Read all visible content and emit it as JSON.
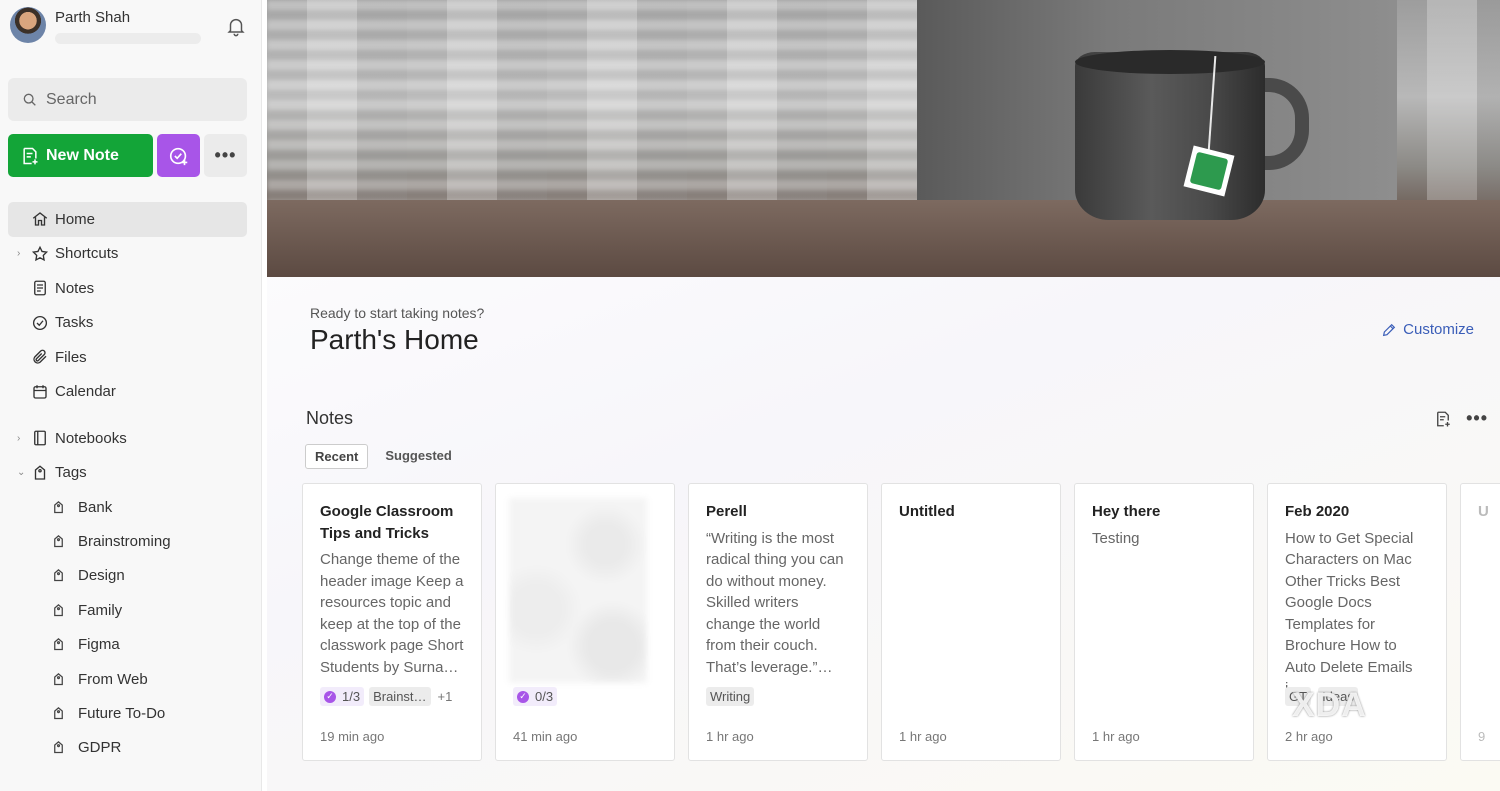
{
  "profile": {
    "name": "Parth Shah"
  },
  "search": {
    "placeholder": "Search"
  },
  "actions": {
    "new_note": "New Note"
  },
  "nav": {
    "home": "Home",
    "shortcuts": "Shortcuts",
    "notes": "Notes",
    "tasks": "Tasks",
    "files": "Files",
    "calendar": "Calendar",
    "notebooks": "Notebooks",
    "tags": "Tags"
  },
  "tags": [
    "Bank",
    "Brainstroming",
    "Design",
    "Family",
    "Figma",
    "From Web",
    "Future To-Do",
    "GDPR"
  ],
  "home": {
    "greeting": "Ready to start taking notes?",
    "title": "Parth's Home",
    "customize": "Customize"
  },
  "notes_widget": {
    "title": "Notes",
    "tabs": [
      "Recent",
      "Suggested"
    ]
  },
  "cards": [
    {
      "title": "Google Classroom Tips and Tricks",
      "body": "Change theme of the header image Keep a resources topic and keep at the top of the classwork page Short Students by Surna…",
      "tasks": "1/3",
      "tag": "Brainst…",
      "extra": "+1",
      "time": "19 min ago"
    },
    {
      "title": "",
      "body": "",
      "tasks": "0/3",
      "time": "41 min ago"
    },
    {
      "title": "Perell",
      "body": "“Writing is the most radical thing you can do without money. Skilled writers change the world from their couch. That’s leverage.”…",
      "tag": "Writing",
      "time": "1 hr ago"
    },
    {
      "title": "Untitled",
      "body": "",
      "time": "1 hr ago"
    },
    {
      "title": "Hey there",
      "body": "Testing",
      "time": "1 hr ago"
    },
    {
      "title": "Feb 2020",
      "body": "How to Get Special Characters on Mac Other Tricks Best Google Docs Templates for Brochure How to Auto Delete Emails i…",
      "tag": "GT",
      "tag2": "Ideas",
      "time": "2 hr ago"
    },
    {
      "title": "U",
      "body": "",
      "time": "9"
    }
  ],
  "watermark": "XDA",
  "colors": {
    "new_note": "#13a538",
    "tasks_button": "#a855e8",
    "link": "#3b5eb8"
  }
}
